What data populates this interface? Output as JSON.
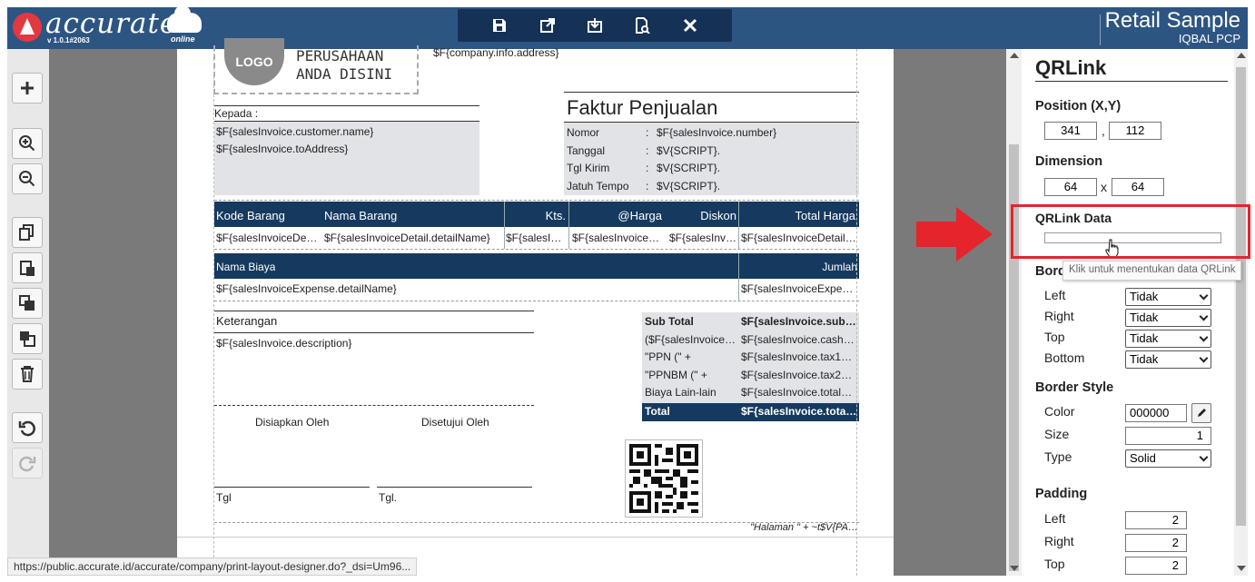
{
  "header": {
    "logo_text": "accurate",
    "version": "v 1.0.1#2063",
    "online": "online",
    "app_title": "Retail Sample",
    "user": "IQBAL PCP",
    "toolbar_icons": [
      "save-icon",
      "export-icon",
      "import-icon",
      "preview-icon",
      "close-icon"
    ]
  },
  "left_toolbar": {
    "icons": [
      "plus-icon",
      "zoom-in-icon",
      "zoom-out-icon",
      "copy-icon",
      "paste-icon",
      "bring-forward-icon",
      "send-backward-icon",
      "trash-icon",
      "undo-icon",
      "redo-icon"
    ]
  },
  "paper": {
    "logo": "LOGO",
    "company_line1": "PERUSAHAAN",
    "company_line2": "ANDA DISINI",
    "company_address": "$F{company.info.address}",
    "kepada_label": "Kepada :",
    "customer_name": "$F{salesInvoice.customer.name}",
    "to_address": "$F{salesInvoice.toAddress}",
    "doc_title": "Faktur Penjualan",
    "info_rows": [
      {
        "label": "Nomor",
        "sep": ":",
        "value": "$F{salesInvoice.number}"
      },
      {
        "label": "Tanggal",
        "sep": ":",
        "value": "$V{SCRIPT}."
      },
      {
        "label": "Tgl Kirim",
        "sep": ":",
        "value": "$V{SCRIPT}."
      },
      {
        "label": "Jatuh Tempo",
        "sep": ":",
        "value": "$V{SCRIPT}."
      }
    ],
    "item_headers": [
      "Kode Barang",
      "Nama Barang",
      "Kts.",
      "@Harga",
      "Diskon",
      "Total Harga"
    ],
    "item_cells": [
      "$F{salesInvoiceDe…",
      "$F{salesInvoiceDetail.detailName}",
      "$F{salesI…",
      "$F{salesInvoice…",
      "$F{salesInv…",
      "$F{salesInvoiceDetail…"
    ],
    "expense_headers": [
      "Nama Biaya",
      "Jumlah"
    ],
    "expense_cells": [
      "$F{salesInvoiceExpense.detailName}",
      "$F{salesInvoiceExpe…"
    ],
    "notes_label": "Keterangan",
    "notes_value": "$F{salesInvoice.description}",
    "totals": [
      {
        "label": "Sub Total",
        "value": "$F{salesInvoice.sub…",
        "bold": true
      },
      {
        "label": "($F{salesInvoice…",
        "value": "$F{salesInvoice.cash…",
        "bold": false
      },
      {
        "label": "\"PPN (\" +",
        "value": "$F{salesInvoice.tax1…",
        "bold": false
      },
      {
        "label": "\"PPNBM (\" +",
        "value": "$F{salesInvoice.tax2…",
        "bold": false
      },
      {
        "label": "Biaya Lain-lain",
        "value": "$F{salesInvoice.total…",
        "bold": false
      }
    ],
    "total_label": "Total",
    "total_value": "$F{salesInvoice.tota…",
    "prepared_by": "Disiapkan Oleh",
    "approved_by": "Disetujui Oleh",
    "date1": "Tgl",
    "date2": "Tgl.",
    "footer": "\"Halaman \" + ~t$V{PA…"
  },
  "panel": {
    "title": "QRLink",
    "position_label": "Position (X,Y)",
    "pos_x": "341",
    "pos_sep": ",",
    "pos_y": "112",
    "dimension_label": "Dimension",
    "dim_w": "64",
    "dim_sep": "x",
    "dim_h": "64",
    "qrlink_data_label": "QRLink Data",
    "qrlink_data_value": "",
    "tooltip": "Klik untuk menentukan data QRLink",
    "border_label": "Border",
    "border_rows": [
      {
        "label": "Left",
        "value": "Tidak"
      },
      {
        "label": "Right",
        "value": "Tidak"
      },
      {
        "label": "Top",
        "value": "Tidak"
      },
      {
        "label": "Bottom",
        "value": "Tidak"
      }
    ],
    "border_style_label": "Border Style",
    "color_label": "Color",
    "color_value": "000000",
    "size_label": "Size",
    "size_value": "1",
    "type_label": "Type",
    "type_value": "Solid",
    "padding_label": "Padding",
    "padding_rows": [
      {
        "label": "Left",
        "value": "2"
      },
      {
        "label": "Right",
        "value": "2"
      },
      {
        "label": "Top",
        "value": "2"
      }
    ]
  },
  "status_url": "https://public.accurate.id/accurate/company/print-layout-designer.do?_dsi=Um96...",
  "colors": {
    "header": "#2d5582",
    "toolbar": "#153256",
    "table_header": "#163a5f",
    "highlight": "#e5242c",
    "arrow": "#e5242c"
  }
}
